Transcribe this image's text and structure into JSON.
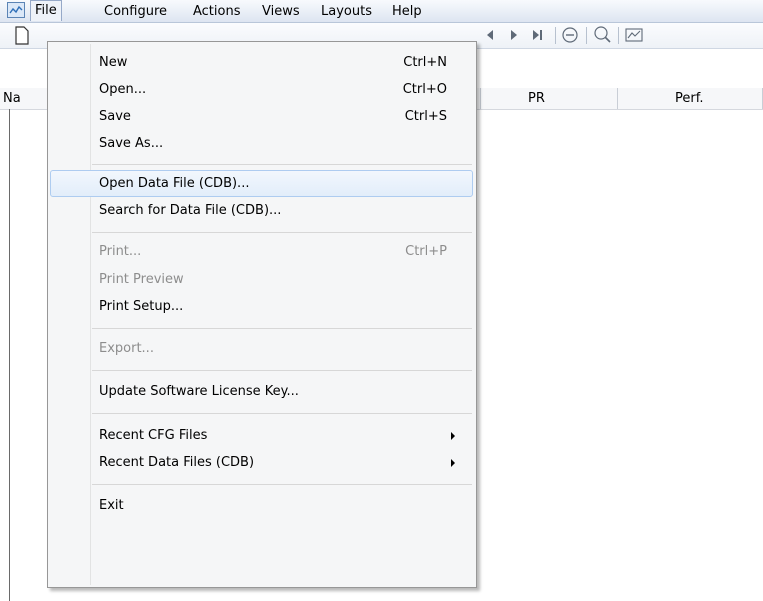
{
  "menubar": {
    "items": [
      {
        "label": "File",
        "active": true
      },
      {
        "label": "Configure"
      },
      {
        "label": "Actions"
      },
      {
        "label": "Views"
      },
      {
        "label": "Layouts"
      },
      {
        "label": "Help"
      }
    ]
  },
  "toolbar": {
    "icons": [
      "new-document-icon",
      "step-back-icon",
      "play-icon",
      "step-end-icon",
      "stop-icon",
      "zoom-icon",
      "chart-icon"
    ]
  },
  "grid": {
    "columns": [
      "Na",
      "PR",
      "Perf."
    ]
  },
  "file_menu": {
    "items": [
      {
        "label": "New",
        "shortcut": "Ctrl+N"
      },
      {
        "label": "Open...",
        "shortcut": "Ctrl+O"
      },
      {
        "label": "Save",
        "shortcut": "Ctrl+S"
      },
      {
        "label": "Save As..."
      },
      {
        "label": "Open Data File (CDB)...",
        "highlighted": true
      },
      {
        "label": "Search for Data File (CDB)..."
      },
      {
        "label": "Print...",
        "shortcut": "Ctrl+P",
        "disabled": true
      },
      {
        "label": "Print Preview",
        "disabled": true
      },
      {
        "label": "Print Setup..."
      },
      {
        "label": "Export...",
        "disabled": true
      },
      {
        "label": "Update Software License Key..."
      },
      {
        "label": "Recent CFG Files",
        "submenu": true
      },
      {
        "label": "Recent Data Files (CDB)",
        "submenu": true
      },
      {
        "label": "Exit"
      }
    ]
  },
  "colors": {
    "highlight_border": "#aeccf0",
    "disabled_text": "#8d8d8d"
  }
}
